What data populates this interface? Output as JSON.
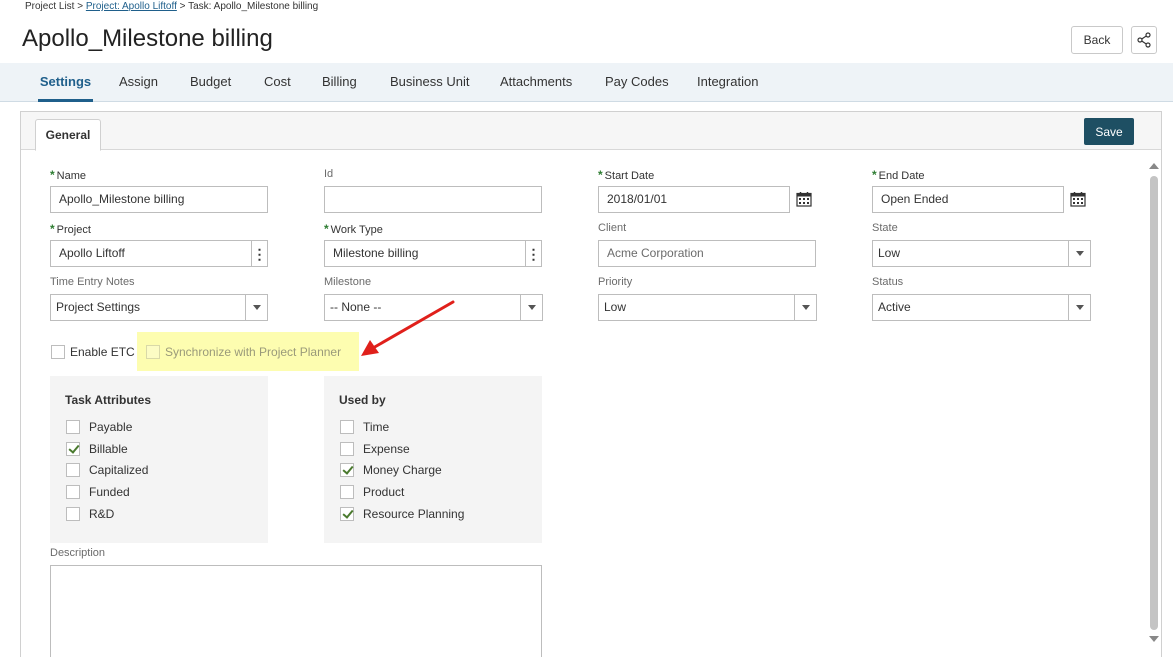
{
  "breadcrumb": {
    "root": "Project List",
    "sep": ">",
    "project": "Project: Apollo Liftoff",
    "task": "Task: Apollo_Milestone billing"
  },
  "header": {
    "title": "Apollo_Milestone billing",
    "back_label": "Back",
    "share_icon": "share-icon"
  },
  "tabs": [
    "Settings",
    "Assign",
    "Budget",
    "Cost",
    "Billing",
    "Business Unit",
    "Attachments",
    "Pay Codes",
    "Integration"
  ],
  "active_tab": "Settings",
  "panel": {
    "subtab": "General",
    "save_label": "Save"
  },
  "fields": {
    "name": {
      "label": "Name",
      "value": "Apollo_Milestone billing"
    },
    "id": {
      "label": "Id",
      "value": ""
    },
    "start_date": {
      "label": "Start Date",
      "value": "2018/01/01"
    },
    "end_date": {
      "label": "End Date",
      "value": "Open Ended"
    },
    "project": {
      "label": "Project",
      "value": "Apollo Liftoff"
    },
    "work_type": {
      "label": "Work Type",
      "value": "Milestone billing"
    },
    "client": {
      "label": "Client",
      "value": "Acme Corporation"
    },
    "state": {
      "label": "State",
      "value": "Low"
    },
    "time_entry_notes": {
      "label": "Time Entry Notes",
      "value": "Project Settings"
    },
    "milestone": {
      "label": "Milestone",
      "value": "-- None --"
    },
    "priority": {
      "label": "Priority",
      "value": "Low"
    },
    "status": {
      "label": "Status",
      "value": "Active"
    }
  },
  "options": {
    "enable_etc": {
      "label": "Enable ETC",
      "checked": false
    },
    "sync_planner": {
      "label": "Synchronize with Project Planner",
      "checked": false
    }
  },
  "task_attributes": {
    "title": "Task Attributes",
    "items": [
      {
        "label": "Payable",
        "checked": false
      },
      {
        "label": "Billable",
        "checked": true
      },
      {
        "label": "Capitalized",
        "checked": false
      },
      {
        "label": "Funded",
        "checked": false
      },
      {
        "label": "R&D",
        "checked": false
      }
    ]
  },
  "used_by": {
    "title": "Used by",
    "items": [
      {
        "label": "Time",
        "checked": false
      },
      {
        "label": "Expense",
        "checked": false
      },
      {
        "label": "Money Charge",
        "checked": true
      },
      {
        "label": "Product",
        "checked": false
      },
      {
        "label": "Resource Planning",
        "checked": true
      }
    ]
  },
  "description": {
    "label": "Description",
    "value": ""
  },
  "colors": {
    "accent": "#1f5f8b",
    "save_button": "#1e4f63",
    "required_star": "#2e7d32",
    "highlight": "#fdfdb0",
    "annotation_arrow": "#e0201b"
  }
}
